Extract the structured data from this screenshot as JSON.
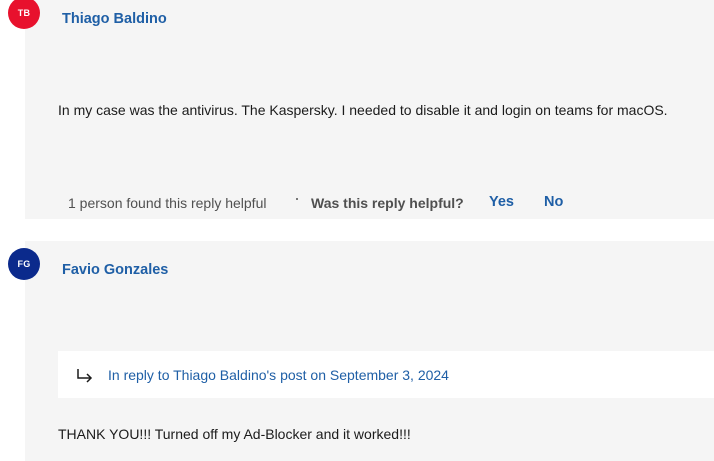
{
  "posts": [
    {
      "avatar_initials": "TB",
      "avatar_color": "#e8112d",
      "author": "Thiago Baldino",
      "body": "In my case was the antivirus. The Kaspersky. I needed to disable it and login on teams for macOS.",
      "helpful_count": "1 person found this reply helpful",
      "helpful_question": "Was this reply helpful?",
      "yes_label": "Yes",
      "no_label": "No"
    },
    {
      "avatar_initials": "FG",
      "avatar_color": "#0b2a8c",
      "author": "Favio Gonzales",
      "reply_to": "In reply to Thiago Baldino's post on September 3, 2024",
      "body": "THANK YOU!!! Turned off my Ad-Blocker and it worked!!!"
    }
  ],
  "colors": {
    "link": "#1f5fa6",
    "card_background": "#f5f5f5"
  },
  "icons": {
    "reply": "reply-arrow-icon"
  }
}
